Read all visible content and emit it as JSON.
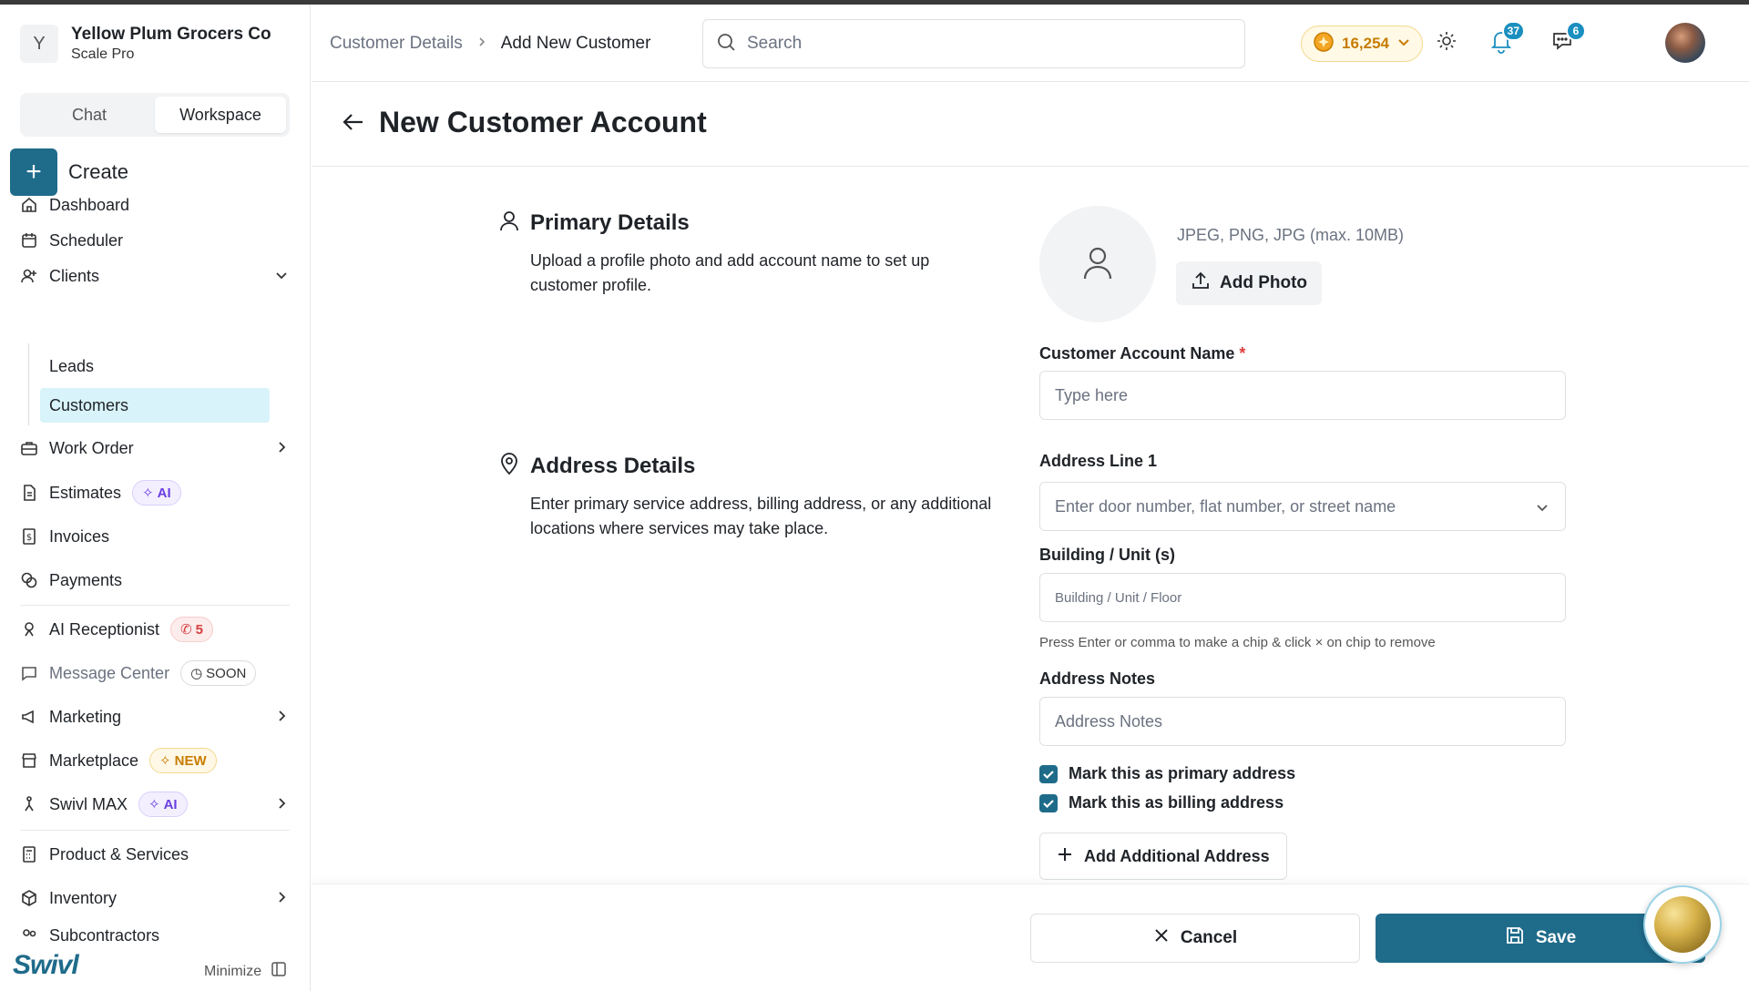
{
  "org": {
    "initial": "Y",
    "name": "Yellow Plum Grocers Co",
    "plan": "Scale Pro"
  },
  "tabs": {
    "chat": "Chat",
    "workspace": "Workspace"
  },
  "create": {
    "label": "Create"
  },
  "nav": {
    "dashboard": "Dashboard",
    "scheduler": "Scheduler",
    "clients": "Clients",
    "leads": "Leads",
    "customers": "Customers",
    "work_order": "Work Order",
    "estimates": "Estimates",
    "estimates_badge": "AI",
    "invoices": "Invoices",
    "payments": "Payments",
    "ai_receptionist": "AI Receptionist",
    "ai_receptionist_badge": "5",
    "message_center": "Message Center",
    "message_center_badge": "SOON",
    "marketing": "Marketing",
    "marketplace": "Marketplace",
    "marketplace_badge": "NEW",
    "swivl_max": "Swivl MAX",
    "swivl_max_badge": "AI",
    "products": "Product & Services",
    "inventory": "Inventory",
    "subcontractors": "Subcontractors"
  },
  "brand": "Swivl",
  "minimize": "Minimize",
  "header": {
    "crumb_parent": "Customer Details",
    "crumb_current": "Add New Customer",
    "search_placeholder": "Search",
    "credits": "16,254",
    "notifications_count": "37",
    "messages_count": "6"
  },
  "page_title": "New Customer Account",
  "primary": {
    "title": "Primary Details",
    "desc_line1": "Upload a profile photo and add account name to set up",
    "desc_line2": "customer profile.",
    "photo_hint": "JPEG, PNG, JPG (max. 10MB)",
    "add_photo": "Add Photo",
    "account_name_label": "Customer Account Name",
    "account_name_required": "*",
    "account_name_placeholder": "Type here"
  },
  "address": {
    "title": "Address Details",
    "desc_line1": "Enter primary service address, billing address, or any additional",
    "desc_line2": "locations where services may take place.",
    "line1_label": "Address Line 1",
    "line1_placeholder": "Enter door number, flat number, or street name",
    "building_label": "Building / Unit (s)",
    "building_placeholder": "Building / Unit / Floor",
    "building_help": "Press Enter or comma to make a chip & click × on chip to remove",
    "notes_label": "Address Notes",
    "notes_placeholder": "Address Notes",
    "primary_check": "Mark this as primary address",
    "billing_check": "Mark this as billing address",
    "add_additional": "Add Additional Address"
  },
  "footer": {
    "cancel": "Cancel",
    "save": "Save"
  },
  "colors": {
    "accent": "#1f6b8a",
    "active_bg": "#d8f3fa",
    "badge": "#1b8fbf",
    "credits": "#c77d00"
  }
}
